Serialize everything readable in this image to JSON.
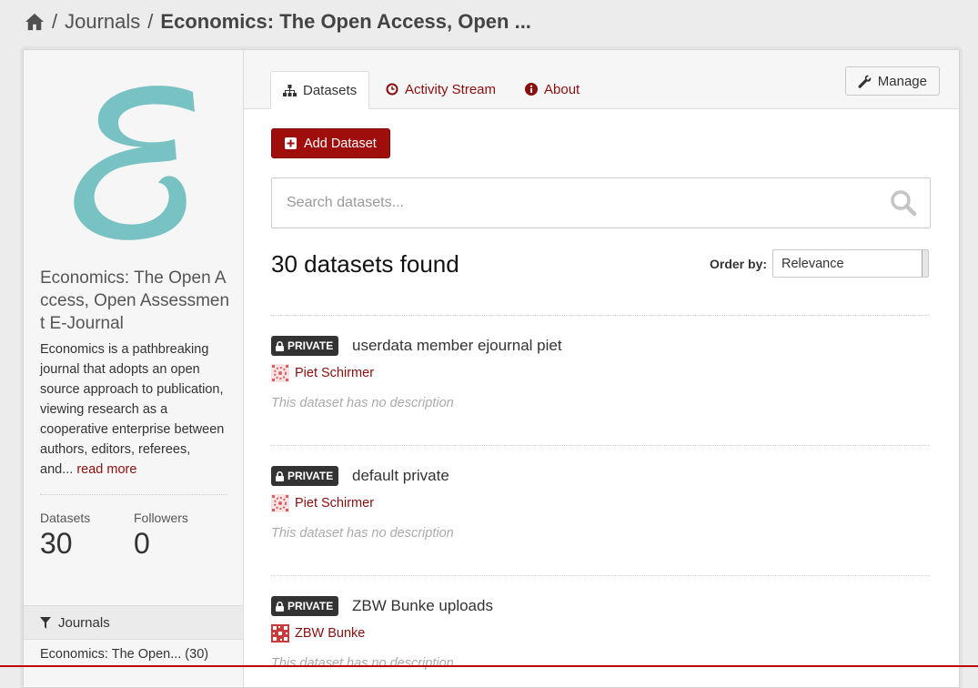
{
  "breadcrumb": {
    "home_icon": "home-icon",
    "section": "Journals",
    "current": "Economics: The Open Access, Open ..."
  },
  "sidebar": {
    "logo_icon": "journal-logo-E",
    "title": "Economics: The Open Access, Open Assessment E-Journal",
    "description": "Economics is a pathbreaking journal that adopts an open source approach to publication, viewing research as a cooperative enterprise between authors, editors, referees, and...",
    "read_more": "read more",
    "stats": {
      "datasets_label": "Datasets",
      "datasets_value": "30",
      "followers_label": "Followers",
      "followers_value": "0"
    },
    "facet": {
      "title": "Journals",
      "icon": "filter-icon",
      "item": "Economics: The Open... (30)"
    }
  },
  "tabs": [
    {
      "label": "Datasets",
      "icon": "sitemap-icon",
      "active": true
    },
    {
      "label": "Activity Stream",
      "icon": "clock-icon",
      "active": false
    },
    {
      "label": "About",
      "icon": "info-icon",
      "active": false
    }
  ],
  "manage": {
    "label": "Manage",
    "icon": "wrench-icon"
  },
  "add_dataset": {
    "label": "Add Dataset",
    "icon": "plus-square-icon"
  },
  "search": {
    "placeholder": "Search datasets...",
    "value": ""
  },
  "results": {
    "count_text": "30 datasets found",
    "order_label": "Order by:",
    "order_value": "Relevance"
  },
  "datasets": [
    {
      "badge": "PRIVATE",
      "title": "userdata member ejournal piet",
      "author": "Piet Schirmer",
      "note": "This dataset has no description"
    },
    {
      "badge": "PRIVATE",
      "title": "default private",
      "author": "Piet Schirmer",
      "note": "This dataset has no description"
    },
    {
      "badge": "PRIVATE",
      "title": "ZBW Bunke uploads",
      "author": "ZBW Bunke",
      "note": "This dataset has no description"
    }
  ],
  "colors": {
    "accent": "#8b0d0d",
    "button_red": "#a00d0d",
    "logo_teal": "#78c2c4",
    "bottom_line": "#c00000"
  }
}
